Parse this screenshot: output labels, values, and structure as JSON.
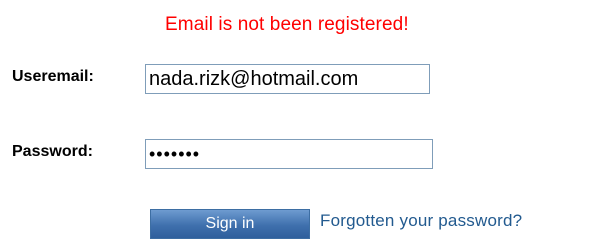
{
  "error_message": "Email is not been registered!",
  "form": {
    "email_label": "Useremail:",
    "email_value": "nada.rizk@hotmail.com",
    "password_label": "Password:",
    "password_value": "1234567"
  },
  "actions": {
    "signin_label": "Sign in",
    "forgot_label": "Forgotten your password?"
  },
  "colors": {
    "error": "#ff0000",
    "button": "#3f70ad",
    "link": "#225a8f"
  }
}
